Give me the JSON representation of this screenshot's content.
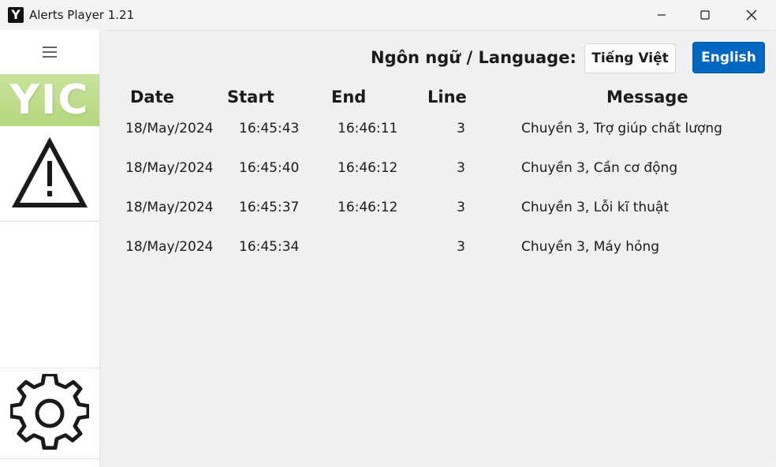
{
  "window": {
    "title": "Alerts Player 1.21",
    "icon_letter": "Y"
  },
  "sidebar": {
    "logo_text": "YIC",
    "items": [
      {
        "name": "menu",
        "icon": "hamburger-menu-icon"
      },
      {
        "name": "alerts",
        "icon": "warning-triangle-icon"
      },
      {
        "name": "settings",
        "icon": "gear-icon"
      }
    ]
  },
  "language": {
    "label": "Ngôn ngữ / Language:",
    "vietnamese_button": "Tiếng Việt",
    "english_button": "English",
    "active": "English"
  },
  "table": {
    "headers": {
      "date": "Date",
      "start": "Start",
      "end": "End",
      "line": "Line",
      "message": "Message"
    },
    "rows": [
      {
        "date": "18/May/2024",
        "start": "16:45:43",
        "end": "16:46:11",
        "line": "3",
        "message": "Chuyền 3, Trợ giúp chất lượng"
      },
      {
        "date": "18/May/2024",
        "start": "16:45:40",
        "end": "16:46:12",
        "line": "3",
        "message": "Chuyền 3, Cần cơ động"
      },
      {
        "date": "18/May/2024",
        "start": "16:45:37",
        "end": "16:46:12",
        "line": "3",
        "message": "Chuyền 3, Lỗi kĩ thuật"
      },
      {
        "date": "18/May/2024",
        "start": "16:45:34",
        "end": "",
        "line": "3",
        "message": "Chuyền 3, Máy hỏng"
      }
    ]
  },
  "colors": {
    "accent": "#0067c0",
    "logo_green": "#c8e39a",
    "background": "#f3f3f3"
  }
}
